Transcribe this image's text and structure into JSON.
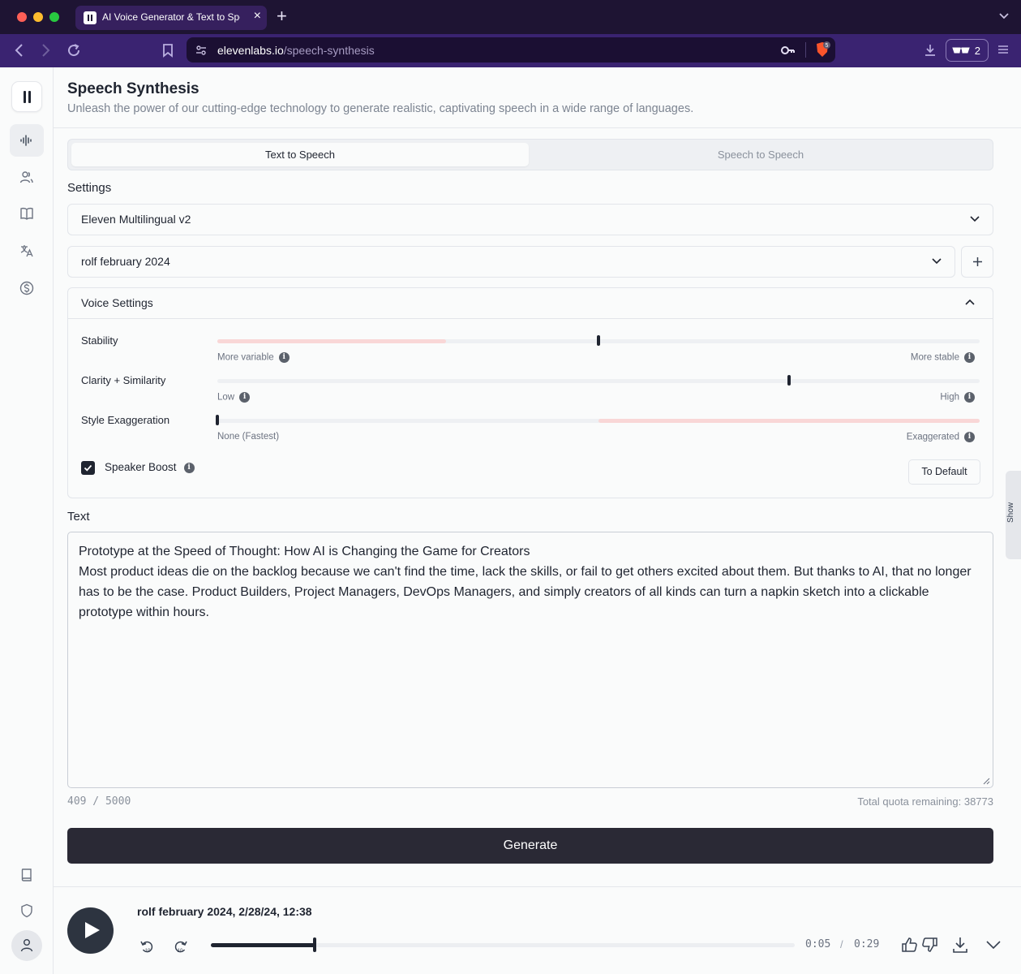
{
  "browser": {
    "tab_title": "AI Voice Generator & Text to Speech",
    "url_host": "elevenlabs.io",
    "url_path": "/speech-synthesis",
    "shields_count": "5",
    "glasses_count": "2"
  },
  "header": {
    "title": "Speech Synthesis",
    "subtitle": "Unleash the power of our cutting-edge technology to generate realistic, captivating speech in a wide range of languages."
  },
  "mode_tabs": [
    "Text to Speech",
    "Speech to Speech"
  ],
  "settings": {
    "label": "Settings",
    "model": "Eleven Multilingual v2",
    "voice": "rolf february 2024"
  },
  "voice_settings": {
    "title": "Voice Settings",
    "sliders": [
      {
        "label": "Stability",
        "min_hint": "More variable",
        "max_hint": "More stable",
        "value": 0.5
      },
      {
        "label": "Clarity + Similarity",
        "min_hint": "Low",
        "max_hint": "High",
        "value": 0.75
      },
      {
        "label": "Style Exaggeration",
        "min_hint": "None (Fastest)",
        "max_hint": "Exaggerated",
        "value": 0.0
      }
    ],
    "speaker_boost": {
      "label": "Speaker Boost",
      "checked": true
    },
    "default_button": "To Default"
  },
  "text": {
    "label": "Text",
    "line1": "Prototype at the Speed of Thought: How AI is Changing the Game for Creators",
    "line2": "Most product ideas die on the backlog because we can't find the time, lack the skills, or fail to get others excited about them. But thanks to AI, that no longer has to be the case. Product Builders, Project Managers, DevOps Managers, and simply creators of all kinds can turn a napkin sketch into a clickable prototype within hours.",
    "counter": "409 / 5000",
    "quota": "Total quota remaining: 38773"
  },
  "generate_label": "Generate",
  "side_panel_label": "Show",
  "player": {
    "title": "rolf february 2024, 2/28/24, 12:38",
    "current": "0:05",
    "duration": "0:29",
    "separator": "/",
    "progress": 0.178
  }
}
